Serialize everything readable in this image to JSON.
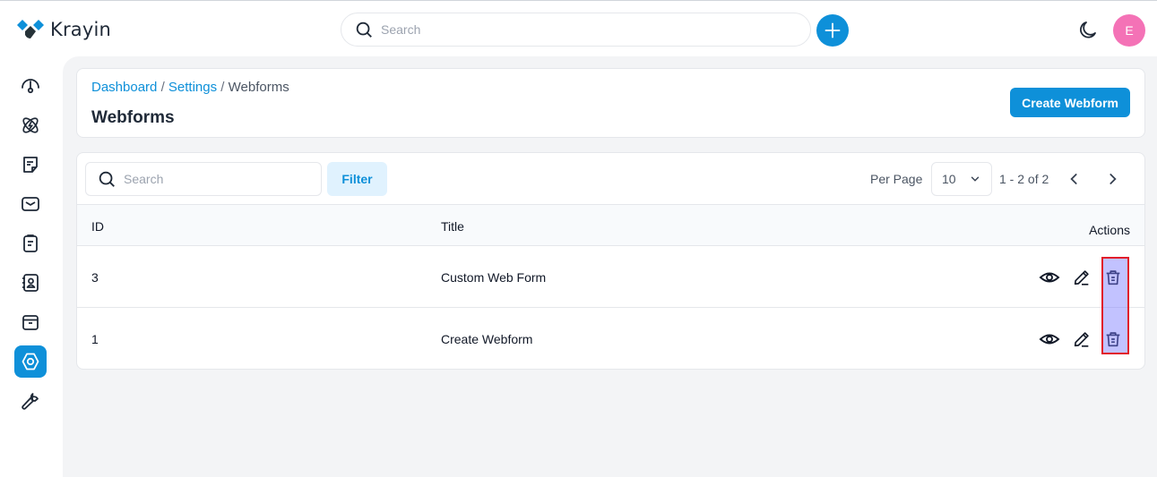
{
  "app": {
    "name": "Krayin",
    "brand_color": "#0e90d9",
    "avatar_initial": "E",
    "avatar_color": "#f472b6"
  },
  "topbar": {
    "search_placeholder": "Search",
    "icons": [
      "search-icon",
      "plus-icon",
      "moon-icon"
    ]
  },
  "sidebar": {
    "items": [
      {
        "name": "dashboard",
        "icon": "gauge-icon",
        "active": false
      },
      {
        "name": "leads",
        "icon": "atom-bolt-icon",
        "active": false
      },
      {
        "name": "quotes",
        "icon": "note-icon",
        "active": false
      },
      {
        "name": "mail",
        "icon": "mail-icon",
        "active": false
      },
      {
        "name": "activities",
        "icon": "clipboard-icon",
        "active": false
      },
      {
        "name": "contacts",
        "icon": "contact-book-icon",
        "active": false
      },
      {
        "name": "products",
        "icon": "archive-box-icon",
        "active": false
      },
      {
        "name": "settings",
        "icon": "settings-hexagon-icon",
        "active": true
      },
      {
        "name": "configuration",
        "icon": "wrench-icon",
        "active": false
      }
    ]
  },
  "header": {
    "breadcrumb": [
      {
        "label": "Dashboard",
        "link": true
      },
      {
        "label": "Settings",
        "link": true
      },
      {
        "label": "Webforms",
        "link": false
      }
    ],
    "separator": "/",
    "title": "Webforms",
    "create_button": "Create Webform"
  },
  "table": {
    "search_placeholder": "Search",
    "filter_label": "Filter",
    "per_page_label": "Per Page",
    "per_page_value": "10",
    "range_text": "1 - 2 of 2",
    "columns": {
      "id": "ID",
      "title": "Title",
      "actions": "Actions"
    },
    "rows": [
      {
        "id": "3",
        "title": "Custom Web Form"
      },
      {
        "id": "1",
        "title": "Create Webform"
      }
    ],
    "row_actions": [
      "view",
      "edit",
      "delete"
    ]
  }
}
